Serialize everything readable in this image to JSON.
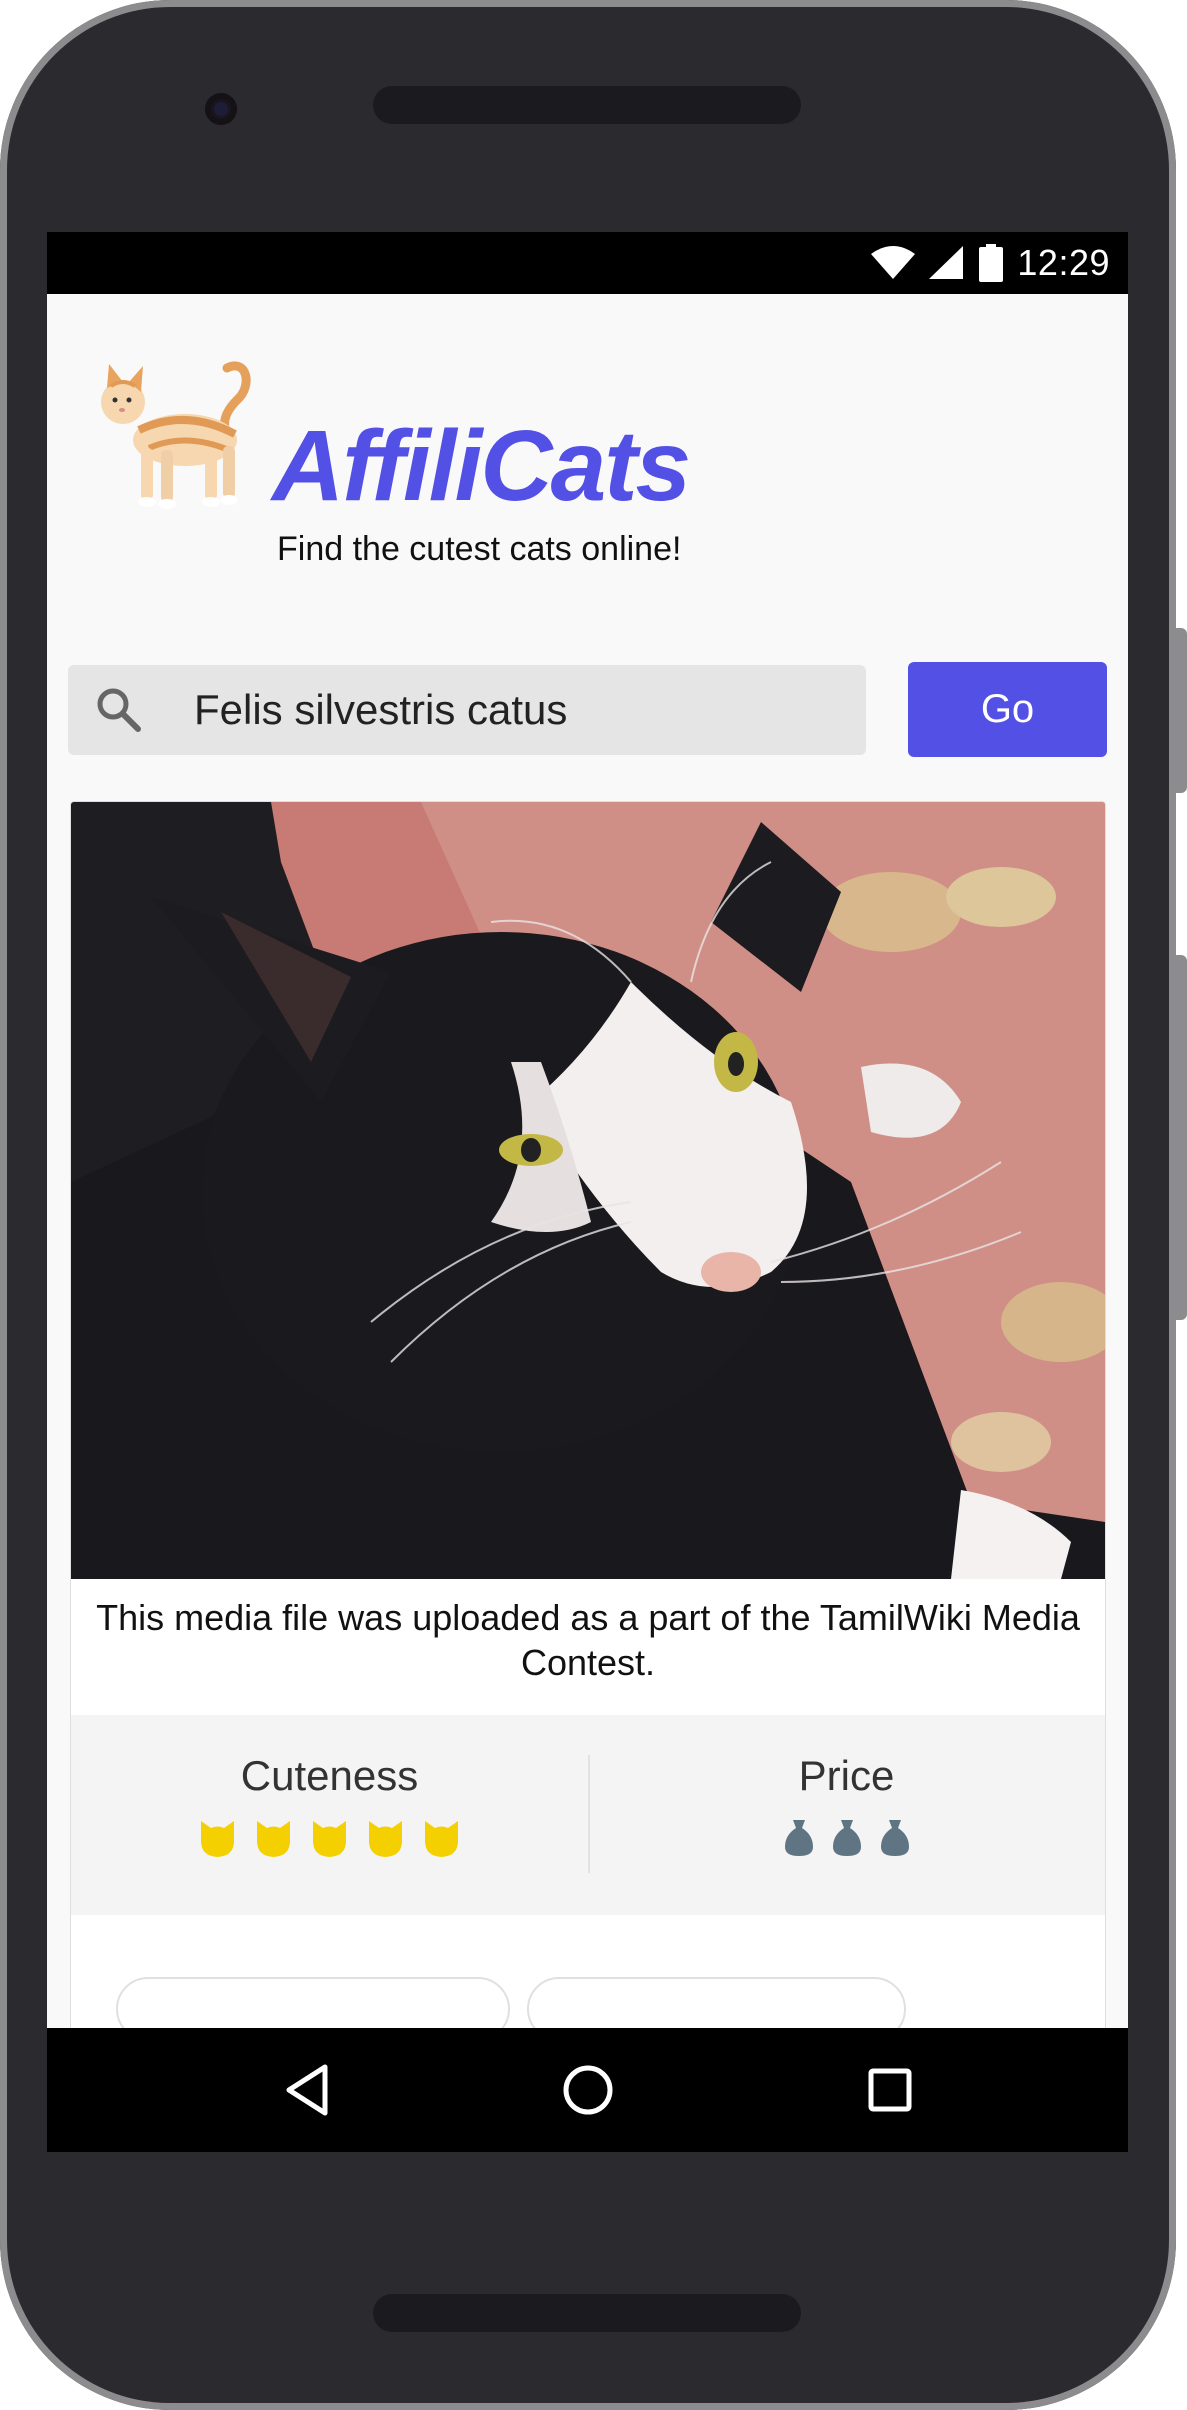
{
  "statusbar": {
    "time": "12:29",
    "icons": [
      "wifi-icon",
      "signal-icon",
      "battery-icon"
    ]
  },
  "header": {
    "logo_icon": "cat-emoji-icon",
    "title": "AffiliCats",
    "tagline": "Find the cutest cats online!"
  },
  "search": {
    "value": "Felis silvestris catus",
    "go_label": "Go"
  },
  "card": {
    "caption": "This media file was uploaded as a part of the TamilWiki Media Contest.",
    "cuteness": {
      "label": "Cuteness",
      "value": 5,
      "icon": "cat-face-icon"
    },
    "price": {
      "label": "Price",
      "value": 3,
      "icon": "money-bag-icon"
    }
  },
  "navbar": {
    "icons": [
      "back-icon",
      "home-icon",
      "recent-apps-icon"
    ]
  },
  "colors": {
    "brand": "#5350e6",
    "cute_icon": "#f5d000",
    "price_icon": "#5f7584"
  }
}
